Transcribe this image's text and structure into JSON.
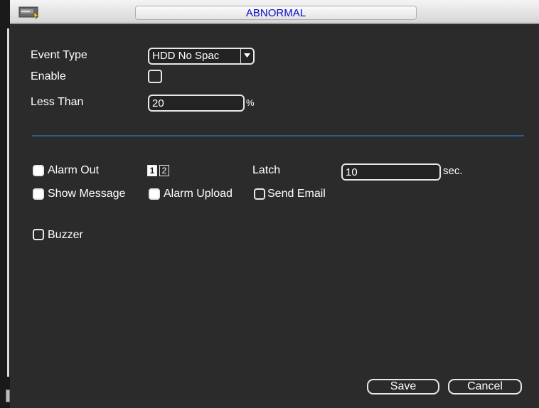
{
  "titlebar": {
    "title": "ABNORMAL",
    "icon": "app-icon"
  },
  "form": {
    "event_type_label": "Event Type",
    "event_type_value": "HDD No Spac",
    "enable_label": "Enable",
    "enable_checked": false,
    "less_than_label": "Less Than",
    "less_than_value": "20",
    "less_than_unit": "%"
  },
  "actions": {
    "alarm_out_label": "Alarm Out",
    "alarm_out_checked": true,
    "alarm_channels": [
      "1",
      "2"
    ],
    "latch_label": "Latch",
    "latch_value": "10",
    "latch_unit": "sec.",
    "show_message_label": "Show Message",
    "show_message_checked": true,
    "alarm_upload_label": "Alarm Upload",
    "alarm_upload_checked": true,
    "send_email_label": "Send Email",
    "send_email_checked": false,
    "buzzer_label": "Buzzer",
    "buzzer_checked": false
  },
  "buttons": {
    "save": "Save",
    "cancel": "Cancel"
  },
  "colors": {
    "background": "#2b2b2b",
    "title_text": "#0a0ad0",
    "divider": "#2c5a8a",
    "text": "#ffffff"
  }
}
